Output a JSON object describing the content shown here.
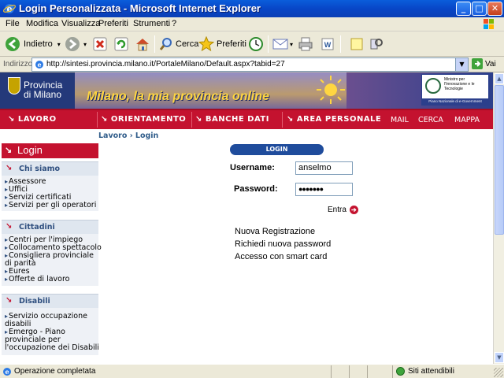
{
  "window": {
    "title": "Login Personalizzata - Microsoft Internet Explorer",
    "controls": [
      "_",
      "□",
      "✕"
    ]
  },
  "menu": [
    "File",
    "Modifica",
    "Visualizza",
    "Preferiti",
    "Strumenti",
    "?"
  ],
  "toolbar": {
    "back_label": "Indietro",
    "search_label": "Cerca",
    "favorites_label": "Preferiti"
  },
  "address": {
    "label": "Indirizzo",
    "url": "http://sintesi.provincia.milano.it/PortaleMilano/Default.aspx?tabid=27",
    "go_label": "Vai"
  },
  "banner": {
    "logo_text_line1": "Provincia",
    "logo_text_line2": "di Milano",
    "slogan": "Milano, la mia provincia online",
    "ministry_text": "Ministro per l'Innovazione e le Tecnologie",
    "ministry_bar": "Piano Nazionale di e-Government"
  },
  "nav": {
    "items": [
      "LAVORO",
      "ORIENTAMENTO",
      "BANCHE DATI",
      "AREA PERSONALE"
    ],
    "links": [
      "MAIL",
      "CERCA",
      "MAPPA"
    ]
  },
  "breadcrumb": "Lavoro › Login",
  "sidebar": {
    "login_title": "Login",
    "sections": [
      {
        "title": "Chi siamo",
        "links": [
          "Assessore",
          "Uffici",
          "Servizi certificati",
          "Servizi per gli operatori"
        ]
      },
      {
        "title": "Cittadini",
        "links": [
          "Centri per l'impiego",
          "Collocamento spettacolo",
          "Consigliera provinciale",
          "di parità",
          "Eures",
          "Offerte di lavoro"
        ]
      },
      {
        "title": "Disabili",
        "links": [
          "Servizio occupazione",
          "disabili",
          "Emergo - Piano",
          "provinciale per",
          "l'occupazione dei Disabili"
        ]
      }
    ]
  },
  "login_form": {
    "header": "LOGIN",
    "username_label": "Username:",
    "username_value": "anselmo",
    "password_label": "Password:",
    "password_value": "●●●●●●●",
    "enter_label": "Entra"
  },
  "other_links": [
    "Nuova Registrazione",
    "Richiedi nuova password",
    "Accesso con smart card"
  ],
  "status": {
    "text": "Operazione completata",
    "zone": "Siti attendibili"
  },
  "colors": {
    "accent_red": "#c4122f",
    "xp_blue": "#0a5ddb",
    "link_blue": "#2f5c8a"
  }
}
